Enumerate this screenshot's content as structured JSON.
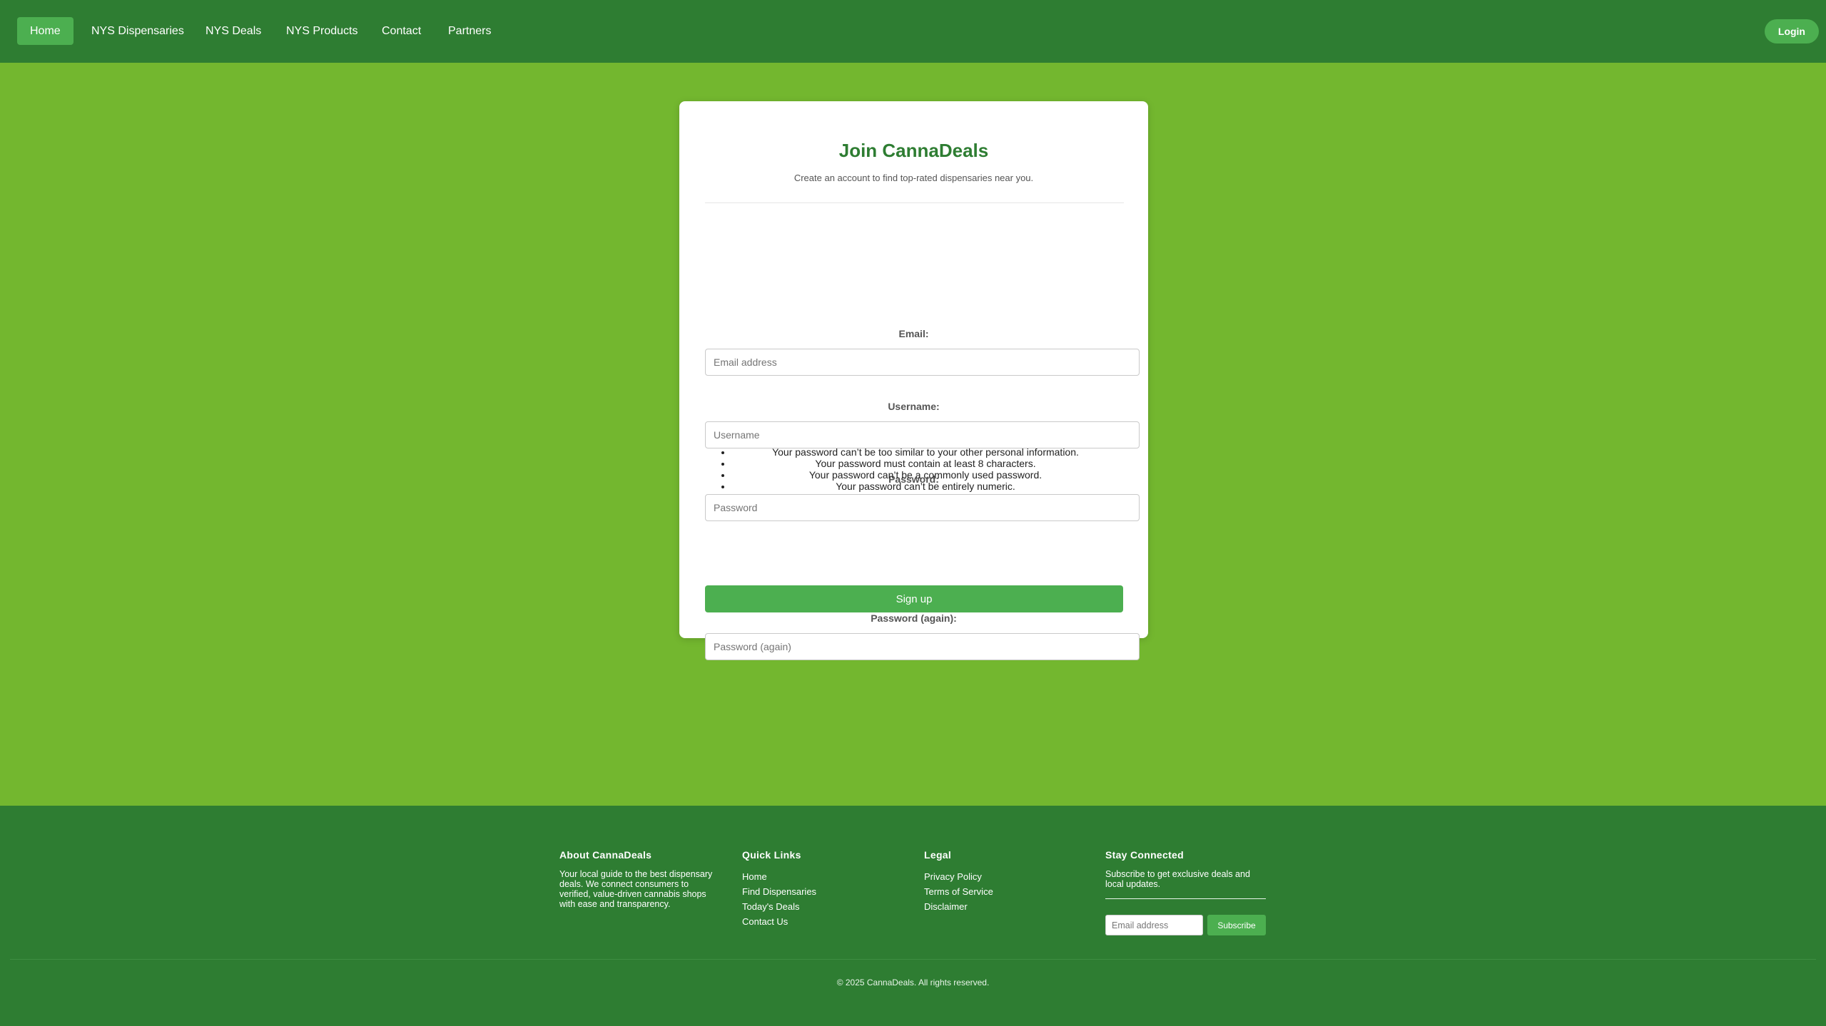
{
  "nav": {
    "items": [
      {
        "label": "Home"
      },
      {
        "label": "NYS Dispensaries"
      },
      {
        "label": "NYS Deals"
      },
      {
        "label": "NYS Products"
      },
      {
        "label": "Contact"
      },
      {
        "label": "Partners"
      }
    ],
    "active_item": "Home",
    "login_label": "Login"
  },
  "signup": {
    "title": "Join CannaDeals",
    "subtitle": "Create an account to find top-rated dispensaries near you.",
    "fields": {
      "email": {
        "label": "Email:",
        "placeholder": "Email address",
        "value": ""
      },
      "username": {
        "label": "Username:",
        "placeholder": "Username",
        "value": ""
      },
      "password": {
        "label": "Password:",
        "placeholder": "Password",
        "value": ""
      },
      "password_again": {
        "label": "Password (again):",
        "placeholder": "Password (again)",
        "value": ""
      }
    },
    "password_help": [
      "Your password can’t be too similar to your other personal information.",
      "Your password must contain at least 8 characters.",
      "Your password can’t be a commonly used password.",
      "Your password can’t be entirely numeric."
    ],
    "submit_label": "Sign up"
  },
  "footer": {
    "about": {
      "heading": "About CannaDeals",
      "text": "Your local guide to the best dispensary deals. We connect consumers to verified, value-driven cannabis shops with ease and transparency."
    },
    "quick_links": {
      "heading": "Quick Links",
      "links": [
        "Home",
        "Find Dispensaries",
        "Today's Deals",
        "Contact Us"
      ]
    },
    "legal": {
      "heading": "Legal",
      "links": [
        "Privacy Policy",
        "Terms of Service",
        "Disclaimer"
      ]
    },
    "newsletter": {
      "heading": "Stay Connected",
      "text": "Subscribe to get exclusive deals and local updates.",
      "input_placeholder": "Email address",
      "button_label": "Subscribe"
    },
    "copyright": "© 2025 CannaDeals. All rights reserved."
  },
  "colors": {
    "page_background": "#73b72f",
    "nav_background": "#2e7d32",
    "accent": "#4caf50",
    "title_green": "#2e7d32",
    "card_background": "#ffffff"
  }
}
